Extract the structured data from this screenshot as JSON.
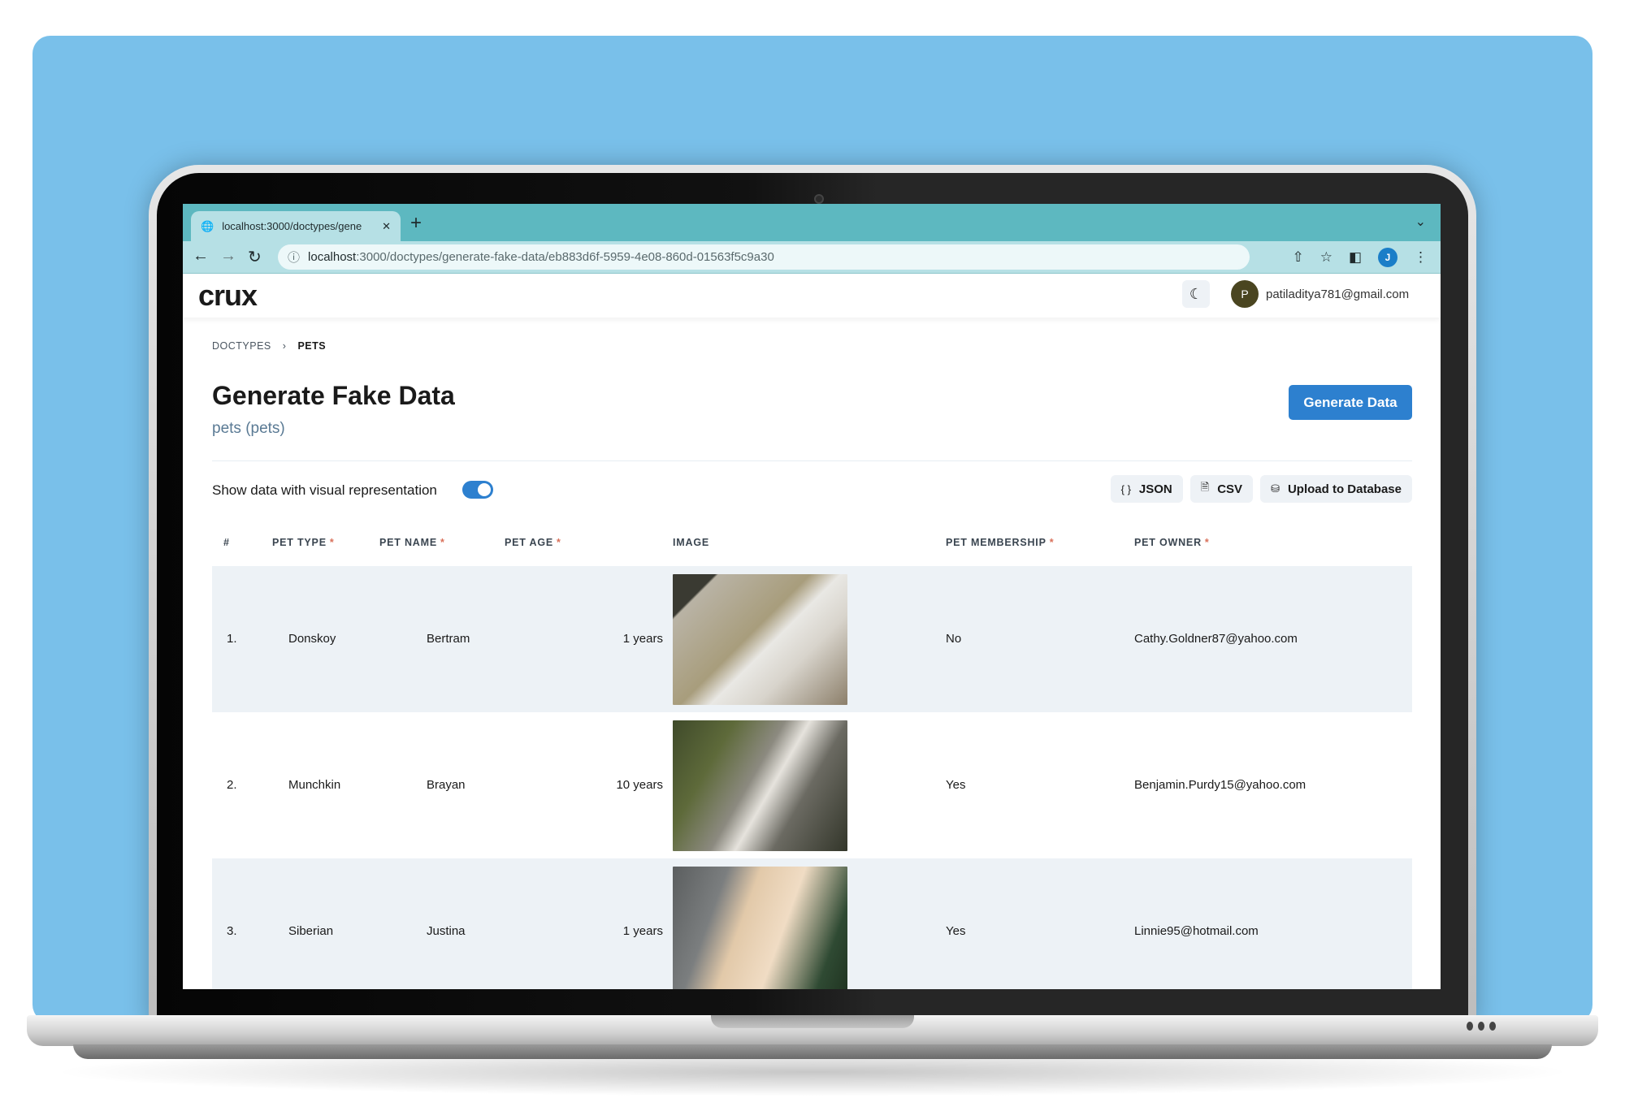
{
  "browser": {
    "tab_title": "localhost:3000/doctypes/gene",
    "new_tab_icon": "plus-icon",
    "url_host": "localhost",
    "url_rest": ":3000/doctypes/generate-fake-data/eb883d6f-5959-4e08-860d-01563f5c9a30",
    "profile_initial": "J"
  },
  "app": {
    "logo": "crux",
    "user_initial": "P",
    "user_email": "patiladitya781@gmail.com"
  },
  "breadcrumb": [
    "DOCTYPES",
    "PETS"
  ],
  "page": {
    "title": "Generate Fake Data",
    "subtitle": "pets (pets)",
    "generate_button": "Generate Data",
    "toggle_label": "Show data with visual representation",
    "toggle_on": true
  },
  "actions": {
    "json": "JSON",
    "csv": "CSV",
    "upload": "Upload to Database"
  },
  "table": {
    "columns": [
      "#",
      "PET TYPE",
      "PET NAME",
      "PET AGE",
      "IMAGE",
      "PET MEMBERSHIP",
      "PET OWNER"
    ],
    "required_marker": "*",
    "rows": [
      {
        "index": "1.",
        "pet_type": "Donskoy",
        "pet_name": "Bertram",
        "pet_age": "1 years",
        "membership": "No",
        "owner": "Cathy.Goldner87@yahoo.com"
      },
      {
        "index": "2.",
        "pet_type": "Munchkin",
        "pet_name": "Brayan",
        "pet_age": "10 years",
        "membership": "Yes",
        "owner": "Benjamin.Purdy15@yahoo.com"
      },
      {
        "index": "3.",
        "pet_type": "Siberian",
        "pet_name": "Justina",
        "pet_age": "1 years",
        "membership": "Yes",
        "owner": "Linnie95@hotmail.com"
      }
    ]
  },
  "colors": {
    "background": "#79c0ea",
    "accent": "#2d80cf",
    "tabbar": "#5db8c0",
    "required": "#d9705a"
  }
}
